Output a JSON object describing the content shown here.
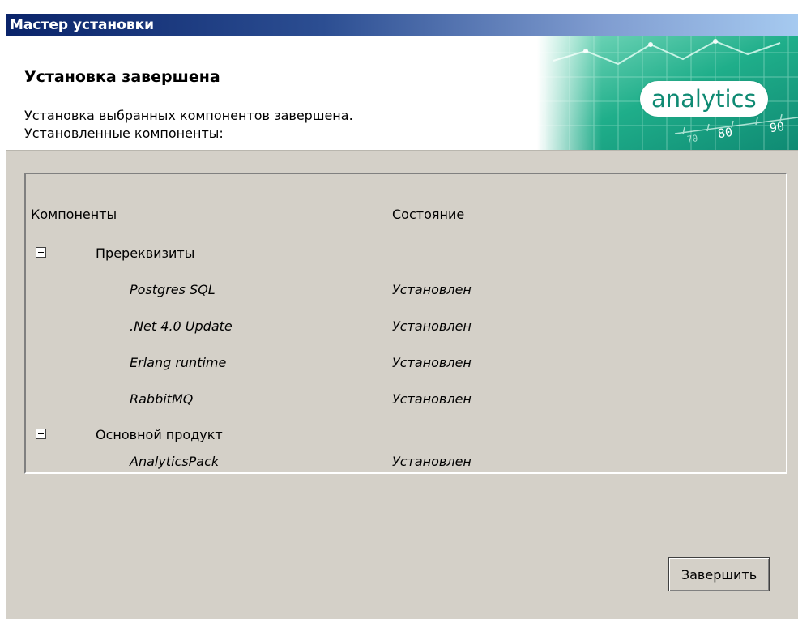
{
  "window": {
    "title": "Мастер установки"
  },
  "header": {
    "title": "Установка завершена",
    "description_line1": "Установка выбранных компонентов завершена.",
    "description_line2": "Установленные компоненты:",
    "brand": "analytics",
    "banner_numbers": [
      "80",
      "90",
      "70"
    ],
    "banner_colors": [
      "#0f8a73",
      "#1fae8a",
      "#7fdcc0"
    ]
  },
  "table": {
    "columns": [
      "Компоненты",
      "Состояние"
    ],
    "rows": [
      {
        "type": "group",
        "name": "Пререквизиты",
        "state": "",
        "icon": "collapse-minus-icon"
      },
      {
        "type": "item",
        "name": "Postgres SQL",
        "state": "Установлен"
      },
      {
        "type": "item",
        "name": ".Net 4.0 Update",
        "state": "Установлен"
      },
      {
        "type": "item",
        "name": "Erlang runtime",
        "state": "Установлен"
      },
      {
        "type": "item",
        "name": "RabbitMQ",
        "state": "Установлен"
      },
      {
        "type": "group",
        "name": "Основной продукт",
        "state": "",
        "icon": "collapse-minus-icon"
      },
      {
        "type": "item",
        "name": "AnalyticsPack",
        "state": "Установлен"
      }
    ]
  },
  "footer": {
    "finish_label": "Завершить"
  }
}
